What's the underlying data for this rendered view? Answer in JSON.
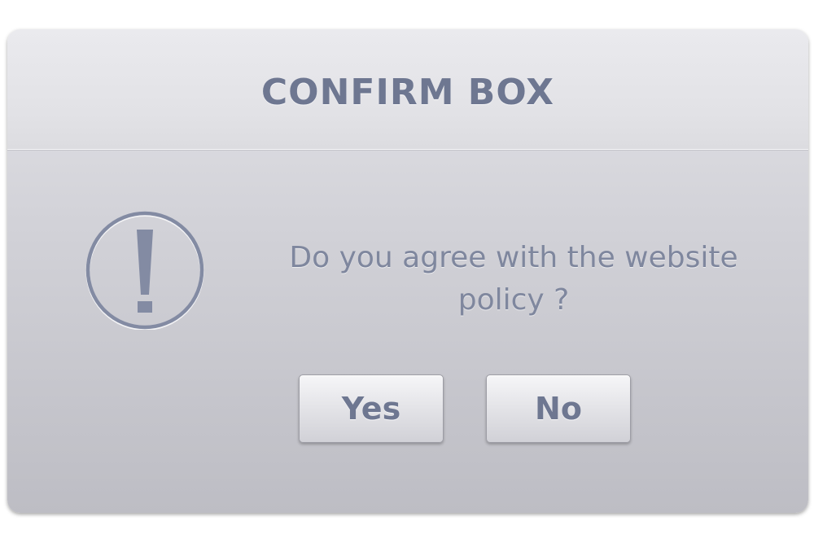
{
  "dialog": {
    "title": "CONFIRM BOX",
    "icon": "exclamation-circle-icon",
    "message_line1": "Do you agree with the website",
    "message_line2": "policy ?",
    "buttons": {
      "yes_label": "Yes",
      "no_label": "No"
    }
  },
  "colors": {
    "text": "#6e7791",
    "dialog_background": "#d2d2d8"
  }
}
